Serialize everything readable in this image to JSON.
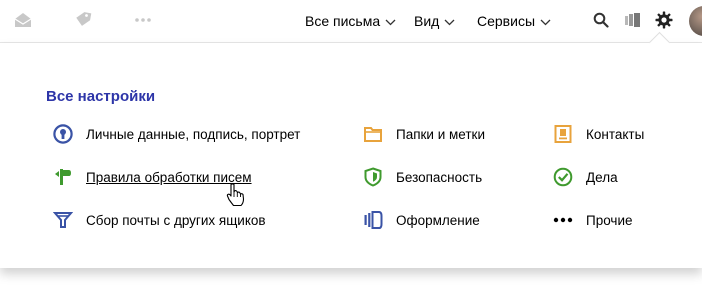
{
  "topbar": {
    "menu": [
      {
        "label": "Все письма"
      },
      {
        "label": "Вид"
      },
      {
        "label": "Сервисы"
      }
    ]
  },
  "settings": {
    "title": "Все настройки",
    "items": [
      {
        "label": "Личные данные, подпись, портрет",
        "icon": "user-circle-icon",
        "color": "#3a53a6"
      },
      {
        "label": "Папки и метки",
        "icon": "folder-icon",
        "color": "#e8a33c"
      },
      {
        "label": "Контакты",
        "icon": "contacts-card-icon",
        "color": "#e8a33c"
      },
      {
        "label": "Правила обработки писем",
        "icon": "rules-flag-icon",
        "color": "#3f9a2e"
      },
      {
        "label": "Безопасность",
        "icon": "shield-icon",
        "color": "#3f9a2e"
      },
      {
        "label": "Дела",
        "icon": "checkmark-circle-icon",
        "color": "#3f9a2e"
      },
      {
        "label": "Сбор почты с других ящиков",
        "icon": "filter-funnel-icon",
        "color": "#3a53a6"
      },
      {
        "label": "Оформление",
        "icon": "theme-icon",
        "color": "#3a53a6"
      },
      {
        "label": "Прочие",
        "icon": "more-dots-icon",
        "color": "#000000"
      }
    ]
  }
}
